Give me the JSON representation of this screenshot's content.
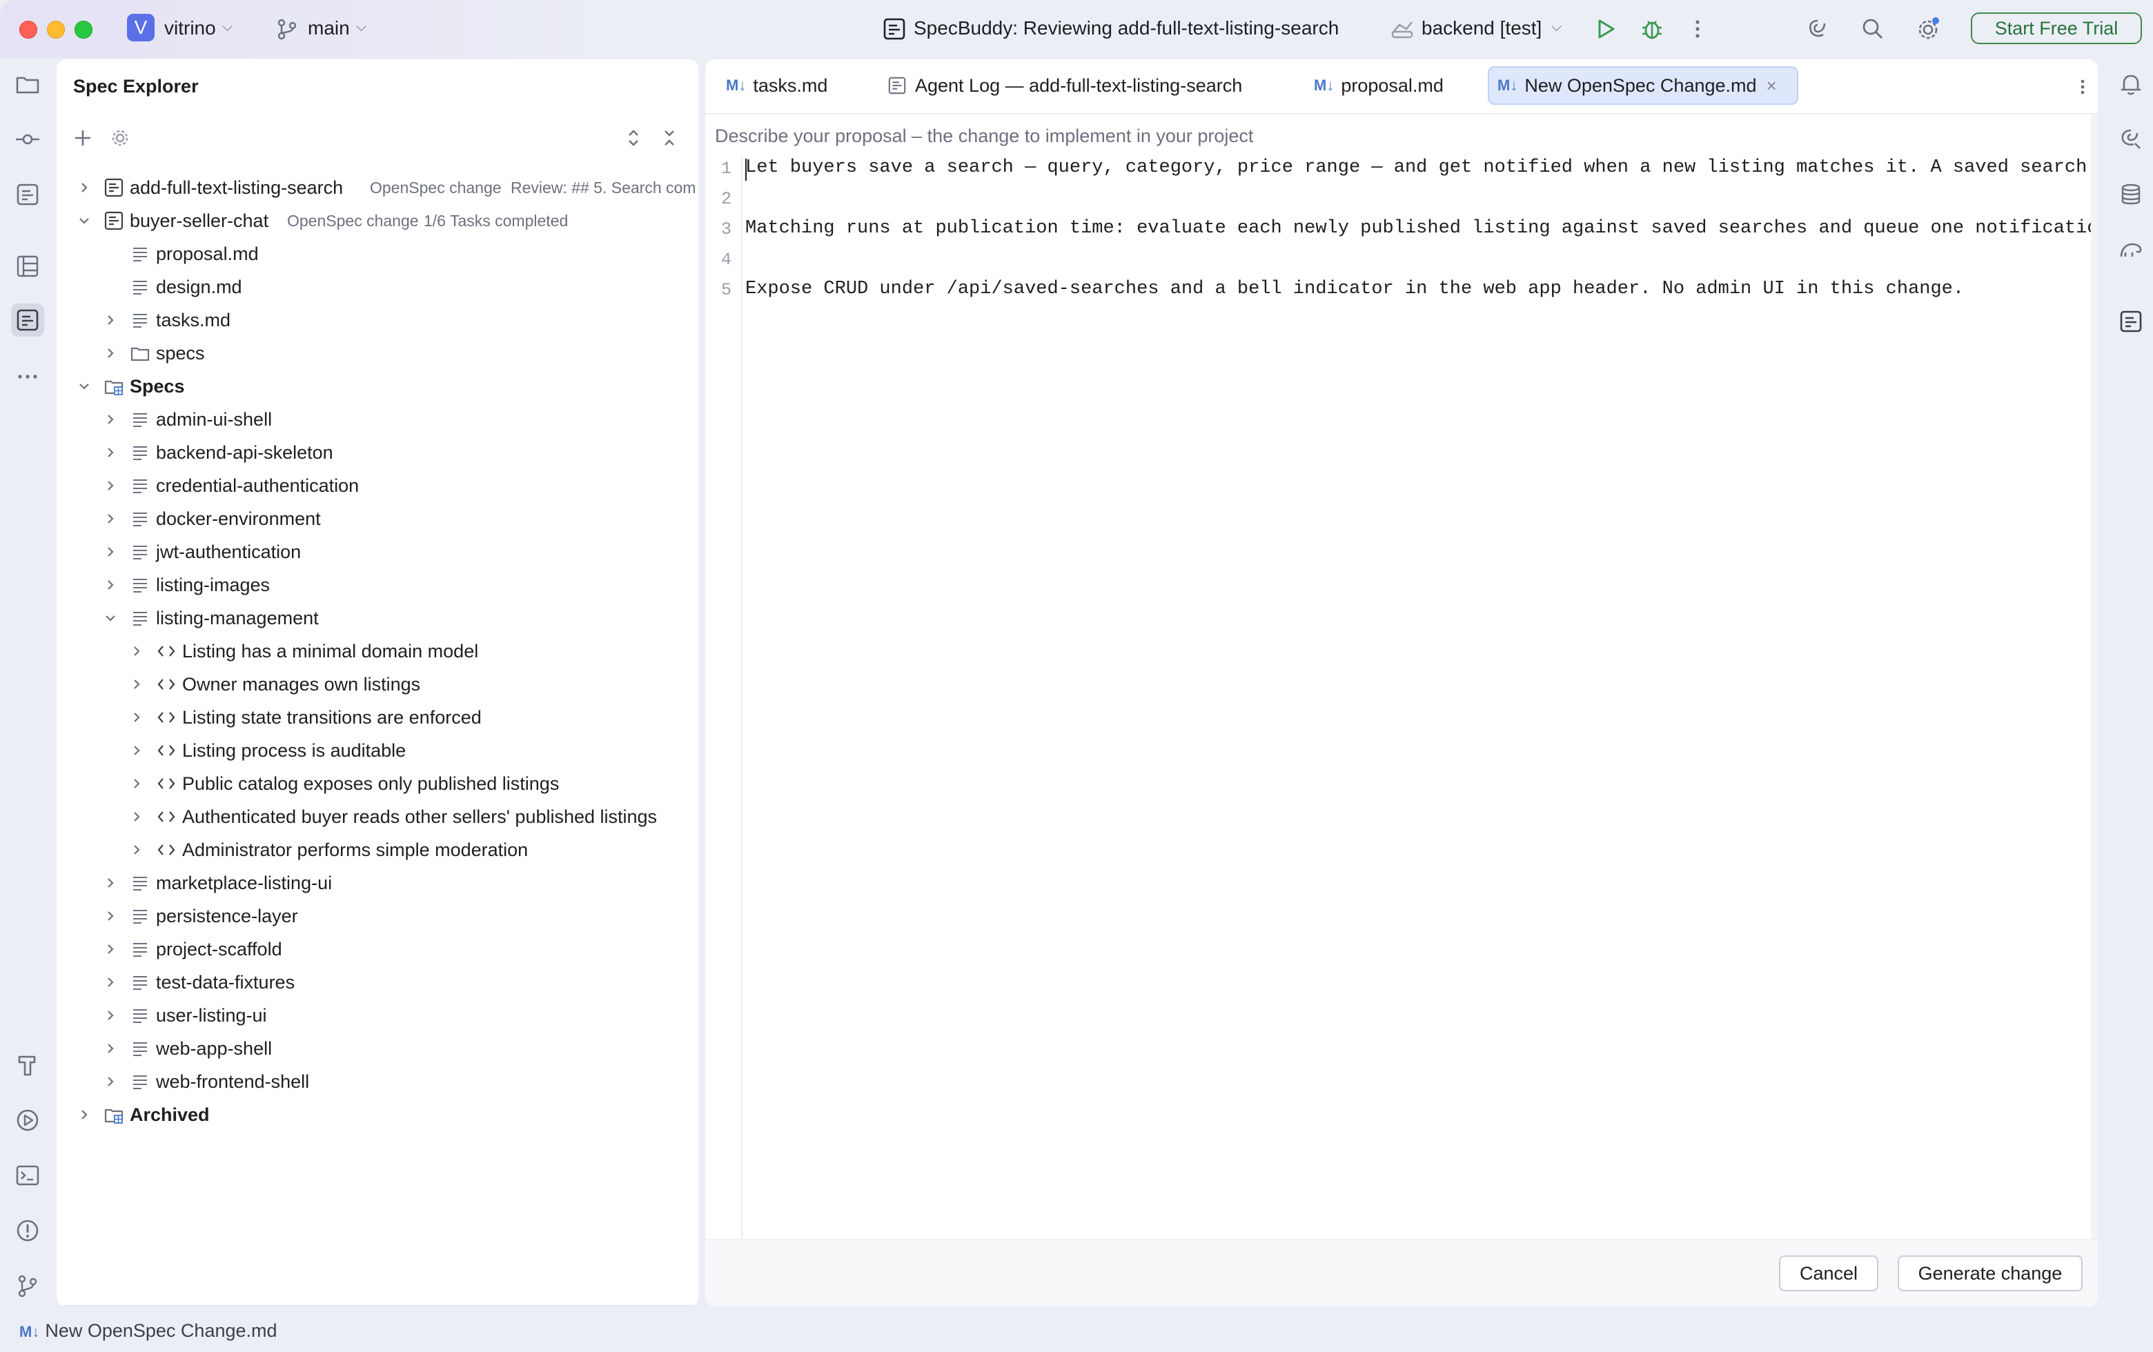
{
  "titlebar": {
    "project_initial": "V",
    "project_name": "vitrino",
    "branch": "main",
    "session_title": "SpecBuddy: Reviewing add-full-text-listing-search",
    "run_config": "backend [test]",
    "start_trial_label": "Start Free Trial"
  },
  "explorer": {
    "title": "Spec Explorer",
    "changes": [
      {
        "name": "add-full-text-listing-search",
        "kind": "OpenSpec change",
        "status": "Review: ## 5. Search com"
      },
      {
        "name": "buyer-seller-chat",
        "kind": "OpenSpec change",
        "status": "1/6 Tasks completed"
      }
    ],
    "change_children": [
      "proposal.md",
      "design.md",
      "tasks.md",
      "specs"
    ],
    "specs_label": "Specs",
    "specs": [
      "admin-ui-shell",
      "backend-api-skeleton",
      "credential-authentication",
      "docker-environment",
      "jwt-authentication",
      "listing-images",
      "listing-management",
      "marketplace-listing-ui",
      "persistence-layer",
      "project-scaffold",
      "test-data-fixtures",
      "user-listing-ui",
      "web-app-shell",
      "web-frontend-shell"
    ],
    "requirements": [
      "Listing has a minimal domain model",
      "Owner manages own listings",
      "Listing state transitions are enforced",
      "Listing process is auditable",
      "Public catalog exposes only published listings",
      "Authenticated buyer reads other sellers' published listings",
      "Administrator performs simple moderation"
    ],
    "archived_label": "Archived"
  },
  "editor": {
    "tabs": [
      {
        "icon": "M↓",
        "label": "tasks.md"
      },
      {
        "icon": "agent-log-icon",
        "label": "Agent Log — add-full-text-listing-search"
      },
      {
        "icon": "M↓",
        "label": "proposal.md"
      },
      {
        "icon": "M↓",
        "label": "New OpenSpec Change.md",
        "active": true
      }
    ],
    "placeholder": "Describe your proposal – the change to implement in your project",
    "lines": [
      {
        "num": "1",
        "text": "Let buyers save a search — query, category, price range — and get notified when a new listing matches it. A saved search belor"
      },
      {
        "num": "2",
        "text": ""
      },
      {
        "num": "3",
        "text": "Matching runs at publication time: evaluate each newly published listing against saved searches and queue one notification per"
      },
      {
        "num": "4",
        "text": ""
      },
      {
        "num": "5",
        "text": "Expose CRUD under /api/saved-searches and a bell indicator in the web app header. No admin UI in this change."
      }
    ],
    "cancel_label": "Cancel",
    "generate_label": "Generate change"
  },
  "status": {
    "icon": "M↓",
    "file": "New OpenSpec Change.md"
  },
  "colors": {
    "accent": "#4a78c9",
    "trial_green": "#25733a",
    "active_tab_bg": "#dfe7fd"
  }
}
